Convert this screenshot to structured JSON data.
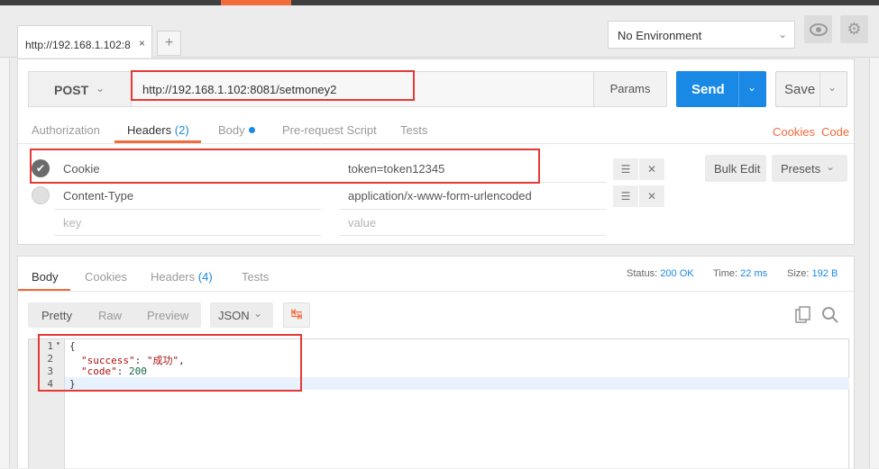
{
  "tabs": [
    {
      "label": "http://192.168.1.102:8",
      "close": "×"
    }
  ],
  "add_tab": "+",
  "environment": {
    "selected": "No Environment"
  },
  "request": {
    "method": "POST",
    "url": "http://192.168.1.102:8081/setmoney2",
    "params_label": "Params",
    "send_label": "Send",
    "save_label": "Save"
  },
  "request_tabs": {
    "authorization": "Authorization",
    "headers": "Headers",
    "headers_count": "(2)",
    "body": "Body",
    "prerequest": "Pre-request Script",
    "tests": "Tests",
    "cookies": "Cookies",
    "code": "Code"
  },
  "headers": [
    {
      "key": "Cookie",
      "value": "token=token12345",
      "enabled": true
    },
    {
      "key": "Content-Type",
      "value": "application/x-www-form-urlencoded",
      "enabled": false
    }
  ],
  "new_header": {
    "key_placeholder": "key",
    "value_placeholder": "value"
  },
  "bulk_edit": "Bulk Edit",
  "presets": "Presets",
  "response_tabs": {
    "body": "Body",
    "cookies": "Cookies",
    "headers": "Headers",
    "headers_count": "(4)",
    "tests": "Tests"
  },
  "status": {
    "status_label": "Status:",
    "status_value": "200 OK",
    "time_label": "Time:",
    "time_value": "22 ms",
    "size_label": "Size:",
    "size_value": "192 B"
  },
  "format": {
    "pretty": "Pretty",
    "raw": "Raw",
    "preview": "Preview",
    "type": "JSON"
  },
  "response_body": {
    "line_numbers": [
      "1",
      "2",
      "3",
      "4"
    ],
    "l1": "{",
    "l2_key": "\"success\"",
    "l2_colon": ": ",
    "l2_value": "\"成功\"",
    "l2_comma": ",",
    "l3_key": "\"code\"",
    "l3_colon": ": ",
    "l3_value": "200",
    "l4": "}"
  },
  "colors": {
    "accent": "#f26b3a",
    "primary": "#1a88e5",
    "highlight": "#e53935"
  }
}
